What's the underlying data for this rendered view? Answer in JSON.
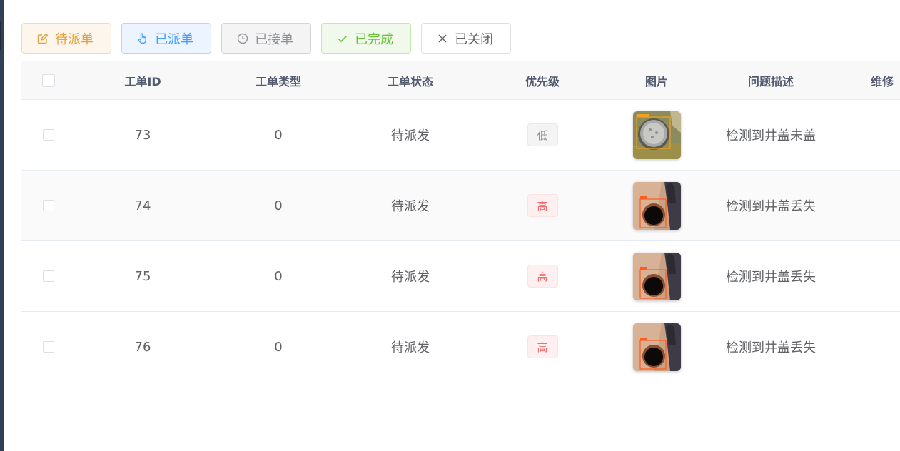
{
  "toolbar": {
    "pending": "待派单",
    "dispatched": "已派单",
    "accepted": "已接单",
    "completed": "已完成",
    "closed": "已关闭"
  },
  "table": {
    "headers": {
      "id": "工单ID",
      "type": "工单类型",
      "status": "工单状态",
      "priority": "优先级",
      "image": "图片",
      "description": "问题描述",
      "repair": "维修"
    },
    "rows": [
      {
        "id": "73",
        "type": "0",
        "status": "待派发",
        "priority": "低",
        "priority_level": "low",
        "image": "manhole-cover-photo",
        "description": "检测到井盖未盖"
      },
      {
        "id": "74",
        "type": "0",
        "status": "待派发",
        "priority": "高",
        "priority_level": "high",
        "image": "open-manhole-photo",
        "description": "检测到井盖丢失"
      },
      {
        "id": "75",
        "type": "0",
        "status": "待派发",
        "priority": "高",
        "priority_level": "high",
        "image": "open-manhole-photo",
        "description": "检测到井盖丢失"
      },
      {
        "id": "76",
        "type": "0",
        "status": "待派发",
        "priority": "高",
        "priority_level": "high",
        "image": "open-manhole-photo",
        "description": "检测到井盖丢失"
      }
    ]
  },
  "colors": {
    "warning": "#e6a23c",
    "primary": "#409eff",
    "info": "#909399",
    "success": "#67c23a",
    "danger": "#f56c6c"
  },
  "icons": {
    "pending": "edit-icon",
    "dispatched": "pointer-icon",
    "accepted": "clock-icon",
    "completed": "check-icon",
    "closed": "close-icon"
  }
}
